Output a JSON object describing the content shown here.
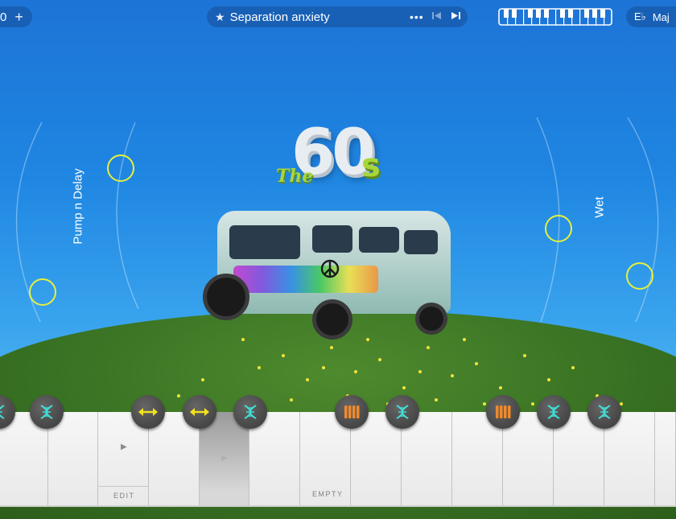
{
  "topbar": {
    "left_counter": "0",
    "add_symbol": "+",
    "preset_title": "Separation anxiety",
    "more_symbol": "•••",
    "prev_symbol": "⏮",
    "next_symbol": "▶︎▎",
    "key_root": "E♭",
    "key_mode": "Maj",
    "chevron": "⌄"
  },
  "controls": {
    "left_label": "Pump n Delay",
    "right_label": "Wet",
    "knob_color": "#e6f03c"
  },
  "logo": {
    "word": "The",
    "number": "60",
    "suffix": "s"
  },
  "piano": {
    "edit_label": "EDIT",
    "empty_label": "EMPTY"
  },
  "buttons": [
    {
      "icon": "dna-icon",
      "color": "#3fe0d8"
    },
    {
      "icon": "dna-icon",
      "color": "#3fe0d8"
    },
    {
      "icon": "arrows-horizontal-icon",
      "color": "#f2e21c"
    },
    {
      "icon": "arrows-horizontal-icon",
      "color": "#f2e21c"
    },
    {
      "icon": "dna-icon",
      "color": "#3fe0d8"
    },
    {
      "icon": "bars-icon",
      "color": "#f08a2c"
    },
    {
      "icon": "dna-icon",
      "color": "#3fe0d8"
    },
    {
      "icon": "bars-icon",
      "color": "#f08a2c"
    },
    {
      "icon": "dna-icon",
      "color": "#3fe0d8"
    },
    {
      "icon": "dna-icon",
      "color": "#3fe0d8"
    }
  ]
}
